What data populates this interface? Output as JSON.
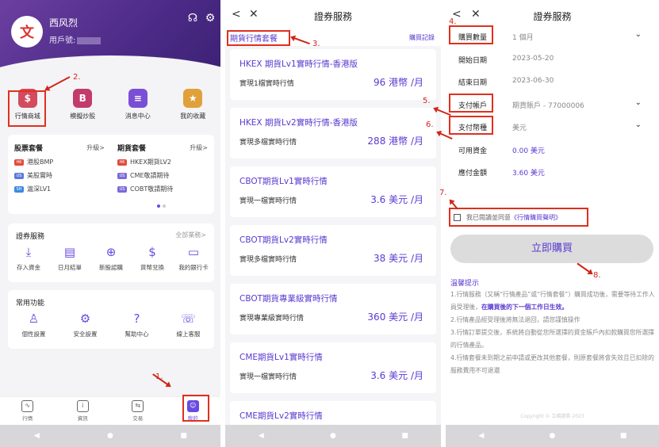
{
  "colors": {
    "brand": "#5a3ad0",
    "header_start": "#6b3fa0",
    "annotation": "#d0261a"
  },
  "panel1": {
    "avatar_glyph": "文",
    "user_name": "西风烈",
    "user_id_label": "用戶號:",
    "header_icons": [
      "headset-icon",
      "gear-icon"
    ],
    "quick": [
      {
        "label": "行情商城",
        "icon": "chart-bag-icon",
        "glyph": "$",
        "color": "#d24b5e"
      },
      {
        "label": "模擬炒股",
        "icon": "b-coin-icon",
        "glyph": "B",
        "color": "#c23b6b"
      },
      {
        "label": "消息中心",
        "icon": "message-icon",
        "glyph": "≡",
        "color": "#7a4fd6"
      },
      {
        "label": "我的收藏",
        "icon": "star-icon",
        "glyph": "★",
        "color": "#e0a03a"
      }
    ],
    "stock_pkg": {
      "title": "股票套餐",
      "more": "升級>",
      "items": [
        {
          "tag": "HK",
          "tag_color": "#e04b3b",
          "text": "港股BMP"
        },
        {
          "tag": "US",
          "tag_color": "#5b7ad8",
          "text": "美股實時"
        },
        {
          "tag": "SH",
          "tag_color": "#3b8ae0",
          "text": "滬深LV1"
        }
      ]
    },
    "futures_pkg": {
      "title": "期貨套餐",
      "more": "升級>",
      "items": [
        {
          "tag": "HK",
          "tag_color": "#e04b3b",
          "text": "HKEX期貨LV2"
        },
        {
          "tag": "US",
          "tag_color": "#7a6ad8",
          "text": "CME敬請期待"
        },
        {
          "tag": "US",
          "tag_color": "#7a6ad8",
          "text": "COBT敬請期待"
        }
      ]
    },
    "securities": {
      "title": "證券服務",
      "more": "全部業務>",
      "items": [
        {
          "label": "存入資金",
          "icon": "deposit-icon",
          "glyph": "⤓"
        },
        {
          "label": "日月結單",
          "icon": "statement-icon",
          "glyph": "▤"
        },
        {
          "label": "新股認購",
          "icon": "ipo-icon",
          "glyph": "⊕"
        },
        {
          "label": "貨幣兌換",
          "icon": "exchange-icon",
          "glyph": "$"
        },
        {
          "label": "我的銀行卡",
          "icon": "bank-card-icon",
          "glyph": "▭"
        }
      ]
    },
    "common": {
      "title": "常用功能",
      "items": [
        {
          "label": "個性設置",
          "icon": "person-settings-icon",
          "glyph": "♙"
        },
        {
          "label": "安全設置",
          "icon": "security-gear-icon",
          "glyph": "⚙"
        },
        {
          "label": "幫助中心",
          "icon": "help-icon",
          "glyph": "?"
        },
        {
          "label": "線上客服",
          "icon": "customer-service-icon",
          "glyph": "☏"
        }
      ]
    },
    "tabs": [
      {
        "label": "行情",
        "icon": "market-tab-icon",
        "glyph": "∿",
        "active": false
      },
      {
        "label": "資訊",
        "icon": "news-tab-icon",
        "glyph": "i",
        "active": false
      },
      {
        "label": "交易",
        "icon": "trade-tab-icon",
        "glyph": "⇆",
        "active": false
      },
      {
        "label": "我的",
        "icon": "profile-tab-icon",
        "glyph": "☺",
        "active": true
      }
    ],
    "step1": "1.",
    "step2": "2."
  },
  "panel2": {
    "title": "證券服務",
    "subtitle": "期貨行情套餐",
    "history": "購買記錄",
    "step3": "3.",
    "plans": [
      {
        "name": "HKEX 期貨Lv1實時行情-香港版",
        "desc": "實現1檔實時行情",
        "price": "96 港幣 /月"
      },
      {
        "name": "HKEX 期貨Lv2實時行情-香港版",
        "desc": "實現多檔實時行情",
        "price": "288 港幣 /月"
      },
      {
        "name": "CBOT期貨Lv1實時行情",
        "desc": "實現一檔實時行情",
        "price": "3.6 美元 /月"
      },
      {
        "name": "CBOT期貨Lv2實時行情",
        "desc": "實現多檔實時行情",
        "price": "38 美元 /月"
      },
      {
        "name": "CBOT期貨專業級實時行情",
        "desc": "實現專業級實時行情",
        "price": "360 美元 /月"
      },
      {
        "name": "CME期貨Lv1實時行情",
        "desc": "實現一檔實時行情",
        "price": "3.6 美元 /月"
      },
      {
        "name": "CME期貨Lv2實時行情",
        "desc": "",
        "price": ""
      }
    ]
  },
  "panel3": {
    "title": "證券服務",
    "rows": [
      {
        "label": "購買數量",
        "value": "1 個月",
        "caret": true,
        "purple": false
      },
      {
        "label": "開始日期",
        "value": "2023-05-20",
        "caret": false,
        "purple": false
      },
      {
        "label": "結束日期",
        "value": "2023-06-30",
        "caret": false,
        "purple": false
      },
      {
        "label": "支付帳戶",
        "value": "期貨賬戶 - 77000006",
        "caret": true,
        "purple": false
      },
      {
        "label": "支付幣種",
        "value": "美元",
        "caret": true,
        "purple": false
      },
      {
        "label": "可用資金",
        "value": "0.00 美元",
        "caret": false,
        "purple": true
      },
      {
        "label": "應付金額",
        "value": "3.60 美元",
        "caret": false,
        "purple": true
      }
    ],
    "agree_prefix": "我已閱讀並同意",
    "agree_link": "《行情購買聲明》",
    "buy": "立即購買",
    "tips_title": "溫馨提示",
    "tip1a": "1.行情服務（又稱“行情產品”或“行情套餐”）購買成功後，需要等待工作人員受理後，",
    "tip1b": "在購買後的下一個工作日生效。",
    "tip2": "2.行情產品經受理後將無法退回，請您謹慎操作",
    "tip3": "3.行情訂單提交後，系統將自動從您所選擇的資金賬戶內扣款購買您所選擇的行情產品。",
    "tip4": "4.行情套餐未到期之前申請或更改其他套餐，則原套餐將會失效且已扣除的服務費用不可退還",
    "copyright": "Copyright © 立橋證券 2023",
    "steps": {
      "s4": "4.",
      "s5": "5.",
      "s6": "6.",
      "s7": "7.",
      "s8": "8."
    }
  }
}
